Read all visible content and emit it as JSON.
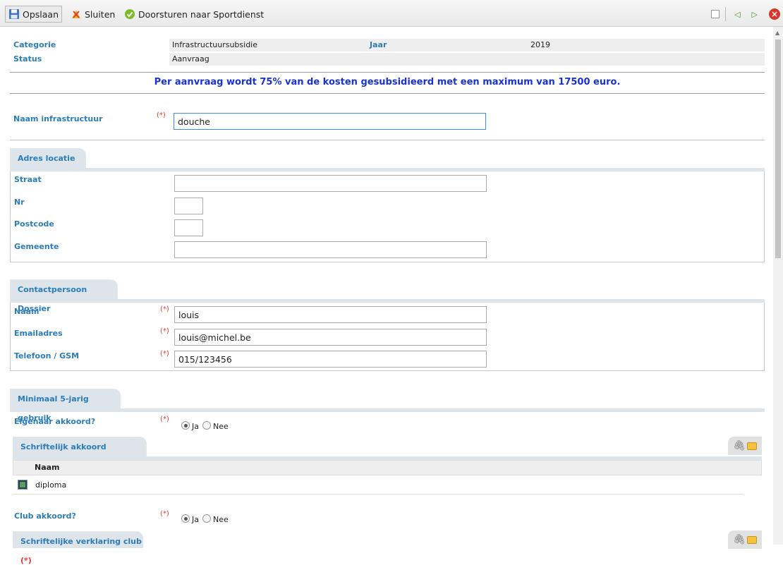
{
  "toolbar": {
    "save_label": "Opslaan",
    "close_label": "Sluiten",
    "forward_label": "Doorsturen naar Sportdienst"
  },
  "header": {
    "category_label": "Categorie",
    "category_value": "Infrastructuursubsidie",
    "year_label": "Jaar",
    "year_value": "2019",
    "status_label": "Status",
    "status_value": "Aanvraag"
  },
  "notice": "Per aanvraag wordt 75% van de kosten gesubsidieerd met een maximum van 17500 euro.",
  "infra": {
    "label": "Naam infrastructuur",
    "required": "(*)",
    "value": "douche"
  },
  "address": {
    "tab": "Adres locatie",
    "street_label": "Straat",
    "street_value": "",
    "nr_label": "Nr",
    "nr_value": "",
    "postcode_label": "Postcode",
    "postcode_value": "",
    "city_label": "Gemeente",
    "city_value": ""
  },
  "contact": {
    "tab": "Contactpersoon Dossier",
    "name_label": "Naam",
    "name_value": "louis",
    "email_label": "Emailadres",
    "email_value": "louis@michel.be",
    "phone_label": "Telefoon / GSM",
    "phone_value": "015/123456",
    "required": "(*)"
  },
  "usage": {
    "tab": "Minimaal 5-jarig gebruik",
    "owner_label": "Eigenaar akkoord?",
    "yes": "Ja",
    "no": "Nee",
    "owner_doc_tab": "Schriftelijk akkoord eigenaar",
    "owner_doc_req": "(*)",
    "grid_col": "Naam",
    "grid_file": "diploma",
    "club_label": "Club akkoord?",
    "club_doc_tab": "Schriftelijke verklaring club",
    "club_doc_req": "(*)",
    "required": "(*)"
  },
  "colors": {
    "label_blue": "#2a7db8",
    "notice_blue": "#1a33d0",
    "required_red": "#e53838",
    "tab_bg": "#dde4ea"
  }
}
